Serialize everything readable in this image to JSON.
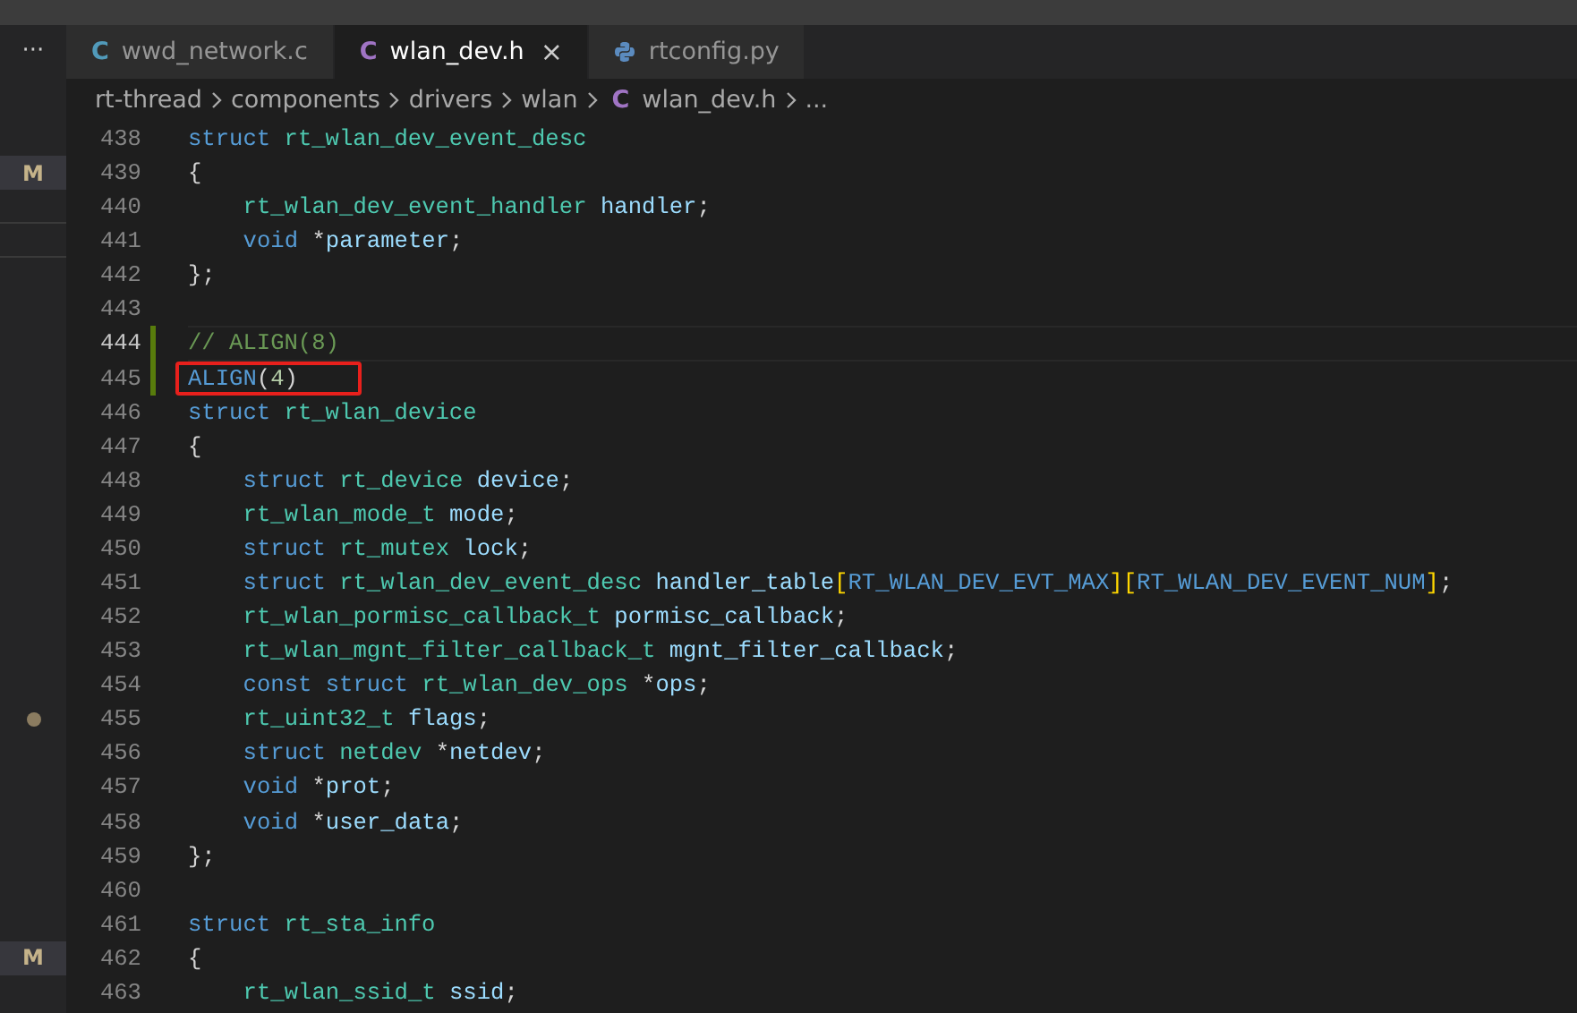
{
  "tabs": [
    {
      "kind": "c",
      "icon_text": "C",
      "label": "wwd_network.c",
      "selected": false
    },
    {
      "kind": "c",
      "icon_text": "C",
      "label": "wlan_dev.h",
      "selected": true,
      "close": "×"
    },
    {
      "kind": "python",
      "label": "rtconfig.py",
      "selected": false
    }
  ],
  "more": "···",
  "breadcrumb": [
    {
      "text": "rt-thread"
    },
    {
      "text": "components"
    },
    {
      "text": "drivers"
    },
    {
      "text": "wlan"
    },
    {
      "text": "wlan_dev.h",
      "icon_text": "C"
    },
    {
      "text": "..."
    }
  ],
  "lines": [
    {
      "number": "438",
      "current": false,
      "changed": false,
      "boxed": false,
      "indented": false,
      "tokens": [
        {
          "kind": "kw",
          "text": "struct "
        },
        {
          "kind": "type",
          "text": "rt_wlan_dev_event_desc"
        }
      ]
    },
    {
      "number": "439",
      "current": false,
      "changed": false,
      "boxed": false,
      "indented": false,
      "panel": {
        "kind": "badge",
        "text": "M"
      },
      "tokens": [
        {
          "kind": "p",
          "text": "{"
        }
      ]
    },
    {
      "number": "440",
      "current": false,
      "changed": false,
      "boxed": false,
      "indented": true,
      "panel": {
        "kind": "divider"
      },
      "tokens": [
        {
          "kind": "type",
          "text": "rt_wlan_dev_event_handler "
        },
        {
          "kind": "var",
          "text": "handler"
        },
        {
          "kind": "p",
          "text": ";"
        }
      ]
    },
    {
      "number": "441",
      "current": false,
      "changed": false,
      "boxed": false,
      "indented": true,
      "panel": {
        "kind": "divider"
      },
      "tokens": [
        {
          "kind": "kw",
          "text": "void "
        },
        {
          "kind": "p",
          "text": "*"
        },
        {
          "kind": "var",
          "text": "parameter"
        },
        {
          "kind": "p",
          "text": ";"
        }
      ]
    },
    {
      "number": "442",
      "current": false,
      "changed": false,
      "boxed": false,
      "indented": false,
      "tokens": [
        {
          "kind": "p",
          "text": "};"
        }
      ]
    },
    {
      "number": "443",
      "current": false,
      "changed": false,
      "boxed": false,
      "indented": false
    },
    {
      "number": "444",
      "current": true,
      "changed": true,
      "boxed": false,
      "indented": false,
      "tokens": [
        {
          "kind": "comment",
          "text": "// ALIGN(8)"
        }
      ]
    },
    {
      "number": "445",
      "current": false,
      "changed": true,
      "boxed": true,
      "indented": false,
      "tokens": [
        {
          "kind": "kw",
          "text": "ALIGN"
        },
        {
          "kind": "p",
          "text": "("
        },
        {
          "kind": "num",
          "text": "4"
        },
        {
          "kind": "p",
          "text": ")"
        }
      ]
    },
    {
      "number": "446",
      "current": false,
      "changed": false,
      "boxed": false,
      "indented": false,
      "tokens": [
        {
          "kind": "kw",
          "text": "struct "
        },
        {
          "kind": "type",
          "text": "rt_wlan_device"
        }
      ]
    },
    {
      "number": "447",
      "current": false,
      "changed": false,
      "boxed": false,
      "indented": false,
      "tokens": [
        {
          "kind": "p",
          "text": "{"
        }
      ]
    },
    {
      "number": "448",
      "current": false,
      "changed": false,
      "boxed": false,
      "indented": true,
      "tokens": [
        {
          "kind": "kw",
          "text": "struct "
        },
        {
          "kind": "type",
          "text": "rt_device "
        },
        {
          "kind": "var",
          "text": "device"
        },
        {
          "kind": "p",
          "text": ";"
        }
      ]
    },
    {
      "number": "449",
      "current": false,
      "changed": false,
      "boxed": false,
      "indented": true,
      "tokens": [
        {
          "kind": "type",
          "text": "rt_wlan_mode_t "
        },
        {
          "kind": "var",
          "text": "mode"
        },
        {
          "kind": "p",
          "text": ";"
        }
      ]
    },
    {
      "number": "450",
      "current": false,
      "changed": false,
      "boxed": false,
      "indented": true,
      "tokens": [
        {
          "kind": "kw",
          "text": "struct "
        },
        {
          "kind": "type",
          "text": "rt_mutex "
        },
        {
          "kind": "var",
          "text": "lock"
        },
        {
          "kind": "p",
          "text": ";"
        }
      ]
    },
    {
      "number": "451",
      "current": false,
      "changed": false,
      "boxed": false,
      "indented": true,
      "tokens": [
        {
          "kind": "kw",
          "text": "struct "
        },
        {
          "kind": "type",
          "text": "rt_wlan_dev_event_desc "
        },
        {
          "kind": "var",
          "text": "handler_table"
        },
        {
          "kind": "br",
          "text": "["
        },
        {
          "kind": "kw",
          "text": "RT_WLAN_DEV_EVT_MAX"
        },
        {
          "kind": "br",
          "text": "]["
        },
        {
          "kind": "kw",
          "text": "RT_WLAN_DEV_EVENT_NUM"
        },
        {
          "kind": "br",
          "text": "]"
        },
        {
          "kind": "p",
          "text": ";"
        }
      ]
    },
    {
      "number": "452",
      "current": false,
      "changed": false,
      "boxed": false,
      "indented": true,
      "tokens": [
        {
          "kind": "type",
          "text": "rt_wlan_pormisc_callback_t "
        },
        {
          "kind": "var",
          "text": "pormisc_callback"
        },
        {
          "kind": "p",
          "text": ";"
        }
      ]
    },
    {
      "number": "453",
      "current": false,
      "changed": false,
      "boxed": false,
      "indented": true,
      "tokens": [
        {
          "kind": "type",
          "text": "rt_wlan_mgnt_filter_callback_t "
        },
        {
          "kind": "var",
          "text": "mgnt_filter_callback"
        },
        {
          "kind": "p",
          "text": ";"
        }
      ]
    },
    {
      "number": "454",
      "current": false,
      "changed": false,
      "boxed": false,
      "indented": true,
      "tokens": [
        {
          "kind": "kw",
          "text": "const struct "
        },
        {
          "kind": "type",
          "text": "rt_wlan_dev_ops "
        },
        {
          "kind": "p",
          "text": "*"
        },
        {
          "kind": "var",
          "text": "ops"
        },
        {
          "kind": "p",
          "text": ";"
        }
      ]
    },
    {
      "number": "455",
      "current": false,
      "changed": false,
      "boxed": false,
      "indented": true,
      "panel": {
        "kind": "dot"
      },
      "tokens": [
        {
          "kind": "type",
          "text": "rt_uint32_t "
        },
        {
          "kind": "var",
          "text": "flags"
        },
        {
          "kind": "p",
          "text": ";"
        }
      ]
    },
    {
      "number": "456",
      "current": false,
      "changed": false,
      "boxed": false,
      "indented": true,
      "tokens": [
        {
          "kind": "kw",
          "text": "struct "
        },
        {
          "kind": "type",
          "text": "netdev "
        },
        {
          "kind": "p",
          "text": "*"
        },
        {
          "kind": "var",
          "text": "netdev"
        },
        {
          "kind": "p",
          "text": ";"
        }
      ]
    },
    {
      "number": "457",
      "current": false,
      "changed": false,
      "boxed": false,
      "indented": true,
      "tokens": [
        {
          "kind": "kw",
          "text": "void "
        },
        {
          "kind": "p",
          "text": "*"
        },
        {
          "kind": "var",
          "text": "prot"
        },
        {
          "kind": "p",
          "text": ";"
        }
      ]
    },
    {
      "number": "458",
      "current": false,
      "changed": false,
      "boxed": false,
      "indented": true,
      "tokens": [
        {
          "kind": "kw",
          "text": "void "
        },
        {
          "kind": "p",
          "text": "*"
        },
        {
          "kind": "var",
          "text": "user_data"
        },
        {
          "kind": "p",
          "text": ";"
        }
      ]
    },
    {
      "number": "459",
      "current": false,
      "changed": false,
      "boxed": false,
      "indented": false,
      "tokens": [
        {
          "kind": "p",
          "text": "};"
        }
      ]
    },
    {
      "number": "460",
      "current": false,
      "changed": false,
      "boxed": false,
      "indented": false
    },
    {
      "number": "461",
      "current": false,
      "changed": false,
      "boxed": false,
      "indented": false,
      "tokens": [
        {
          "kind": "kw",
          "text": "struct "
        },
        {
          "kind": "type",
          "text": "rt_sta_info"
        }
      ]
    },
    {
      "number": "462",
      "current": false,
      "changed": false,
      "boxed": false,
      "indented": false,
      "panel": {
        "kind": "badge",
        "text": "M"
      },
      "tokens": [
        {
          "kind": "p",
          "text": "{"
        }
      ]
    },
    {
      "number": "463",
      "current": false,
      "changed": false,
      "boxed": false,
      "indented": true,
      "tokens": [
        {
          "kind": "type",
          "text": "rt_wlan_ssid_t "
        },
        {
          "kind": "var",
          "text": "ssid"
        },
        {
          "kind": "p",
          "text": ";"
        }
      ]
    }
  ]
}
